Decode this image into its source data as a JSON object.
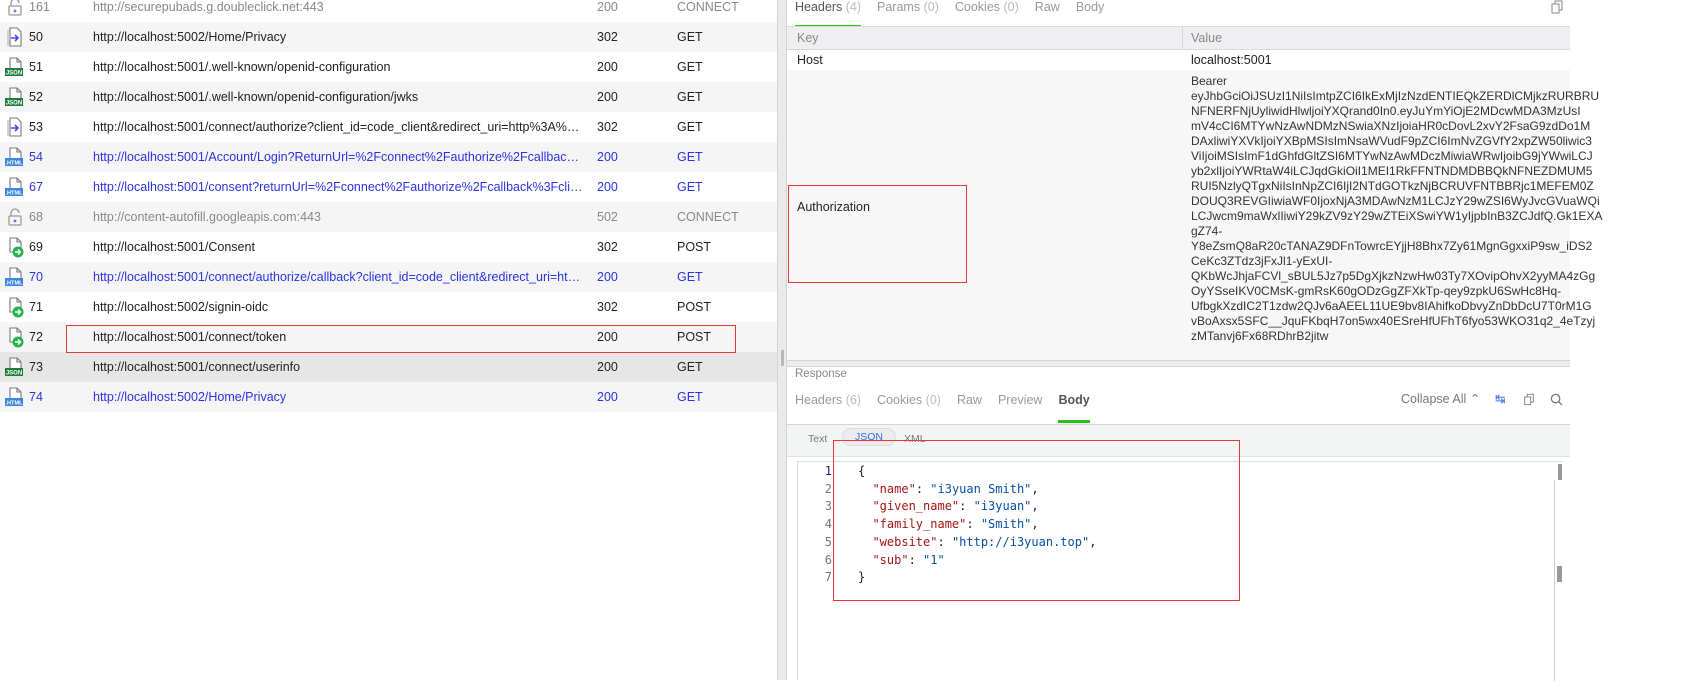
{
  "sessions": [
    {
      "id": "161",
      "url": "http://securepubads.g.doubleclick.net:443",
      "status": "200",
      "method": "CONNECT",
      "icon": "lock-icon",
      "style": "gray"
    },
    {
      "id": "50",
      "url": "http://localhost:5002/Home/Privacy",
      "status": "302",
      "method": "GET",
      "icon": "redirect-icon",
      "style": "normal"
    },
    {
      "id": "51",
      "url": "http://localhost:5001/.well-known/openid-configuration",
      "status": "200",
      "method": "GET",
      "icon": "json-icon",
      "style": "normal"
    },
    {
      "id": "52",
      "url": "http://localhost:5001/.well-known/openid-configuration/jwks",
      "status": "200",
      "method": "GET",
      "icon": "json-icon",
      "style": "normal"
    },
    {
      "id": "53",
      "url": "http://localhost:5001/connect/authorize?client_id=code_client&redirect_uri=http%3A%2F%2...",
      "status": "302",
      "method": "GET",
      "icon": "redirect-icon",
      "style": "normal"
    },
    {
      "id": "54",
      "url": "http://localhost:5001/Account/Login?ReturnUrl=%2Fconnect%2Fauthorize%2Fcallback%3Fcli...",
      "status": "200",
      "method": "GET",
      "icon": "html-icon",
      "style": "blue"
    },
    {
      "id": "67",
      "url": "http://localhost:5001/consent?returnUrl=%2Fconnect%2Fauthorize%2Fcallback%3Fclient_id...",
      "status": "200",
      "method": "GET",
      "icon": "html-icon",
      "style": "blue"
    },
    {
      "id": "68",
      "url": "http://content-autofill.googleapis.com:443",
      "status": "502",
      "method": "CONNECT",
      "icon": "lock-icon",
      "style": "gray"
    },
    {
      "id": "69",
      "url": "http://localhost:5001/Consent",
      "status": "302",
      "method": "POST",
      "icon": "post-icon",
      "style": "normal"
    },
    {
      "id": "70",
      "url": "http://localhost:5001/connect/authorize/callback?client_id=code_client&redirect_uri=http%3...",
      "status": "200",
      "method": "GET",
      "icon": "html-icon",
      "style": "blue"
    },
    {
      "id": "71",
      "url": "http://localhost:5002/signin-oidc",
      "status": "302",
      "method": "POST",
      "icon": "post-icon",
      "style": "normal"
    },
    {
      "id": "72",
      "url": "http://localhost:5001/connect/token",
      "status": "200",
      "method": "POST",
      "icon": "post-icon",
      "style": "normal"
    },
    {
      "id": "73",
      "url": "http://localhost:5001/connect/userinfo",
      "status": "200",
      "method": "GET",
      "icon": "json-icon",
      "style": "selected"
    },
    {
      "id": "74",
      "url": "http://localhost:5002/Home/Privacy",
      "status": "200",
      "method": "GET",
      "icon": "html-icon",
      "style": "blue"
    }
  ],
  "request": {
    "tabs": [
      {
        "label": "Headers",
        "count": "(4)",
        "active": true
      },
      {
        "label": "Params",
        "count": "(0)"
      },
      {
        "label": "Cookies",
        "count": "(0)"
      },
      {
        "label": "Raw",
        "count": ""
      },
      {
        "label": "Body",
        "count": ""
      }
    ],
    "columns": {
      "key": "Key",
      "value": "Value"
    },
    "headers": [
      {
        "key": "Host",
        "value": "localhost:5001"
      },
      {
        "key": "Authorization",
        "value": "Bearer\neyJhbGciOiJSUzI1NiIsImtpZCI6IkExMjIzNzdENTIEQkZERDlCMjkzRURBRU\nNFNERFNjUyliwidHlwljoiYXQrand0In0.eyJuYmYiOjE2MDcwMDA3MzUsI\nmV4cCI6MTYwNzAwNDMzNSwiaXNzIjoiaHR0cDovL2xvY2FsaG9zdDo1M\nDAxliwiYXVkIjoiYXBpMSIsImNsaWVudF9pZCI6ImNvZGVfY2xpZW50liwic3\nViIjoiMSIsImF1dGhfdGltZSI6MTYwNzAwMDczMiwiaWRwIjoibG9jYWwiLCJ\nyb2xlIjoiYWRtaW4iLCJqdGkiOiI1MEI1RkFFNTNDMDBBQkNFNEZDMUM5\nRUI5NzlyQTgxNiIsInNpZCI6IjI2NTdGOTkzNjBCRUVFNTBBRjc1MEFEM0Z\nDOUQ3REVGIiwiaWF0IjoxNjA3MDAwNzM1LCJzY29wZSI6WyJvcGVuaWQi\nLCJwcm9maWxlIiwiY29kZV9zY29wZTEiXSwiYW1yIjpbInB3ZCJdfQ.Gk1EXA\ngZ74-\nY8eZsmQ8aR20cTANAZ9DFnTowrcEYjjH8Bhx7Zy61MgnGgxxiP9sw_iDS2\nCeKc3ZTdz3jFxJl1-yExUI-\nQKbWcJhjaFCVl_sBUL5Jz7p5DgXjkzNzwHw03Ty7XOvipOhvX2yyMA4zGg\nOyYSseIKV0CMsK-gmRsK60gODzGgZFXkTp-qey9zpkU6SwHc8Hq-\nUfbgkXzdIC2T1zdw2QJv6aAEEL11UE9bv8IAhifkoDbvyZnDbDcU7T0rM1G\nvBoAxsx5SFC__JquFKbqH7on5wx40ESreHfUFhT6fyo53WKO31q2_4eTzyj\nzMTanvj6Fx68RDhrB2jitw"
      }
    ]
  },
  "response": {
    "label": "Response",
    "tabs": [
      {
        "label": "Headers",
        "count": "(6)"
      },
      {
        "label": "Cookies",
        "count": "(0)"
      },
      {
        "label": "Raw",
        "count": ""
      },
      {
        "label": "Preview",
        "count": ""
      },
      {
        "label": "Body",
        "count": "",
        "active": true
      }
    ],
    "collapse_all": "Collapse All",
    "formats": [
      "Text",
      "JSON",
      "XML"
    ],
    "active_format": "JSON",
    "code_lines": [
      [
        {
          "t": "p",
          "v": "{"
        }
      ],
      [
        {
          "t": "p",
          "v": "  "
        },
        {
          "t": "k",
          "v": "\"name\""
        },
        {
          "t": "p",
          "v": ": "
        },
        {
          "t": "s",
          "v": "\"i3yuan Smith\""
        },
        {
          "t": "p",
          "v": ","
        }
      ],
      [
        {
          "t": "p",
          "v": "  "
        },
        {
          "t": "k",
          "v": "\"given_name\""
        },
        {
          "t": "p",
          "v": ": "
        },
        {
          "t": "s",
          "v": "\"i3yuan\""
        },
        {
          "t": "p",
          "v": ","
        }
      ],
      [
        {
          "t": "p",
          "v": "  "
        },
        {
          "t": "k",
          "v": "\"family_name\""
        },
        {
          "t": "p",
          "v": ": "
        },
        {
          "t": "s",
          "v": "\"Smith\""
        },
        {
          "t": "p",
          "v": ","
        }
      ],
      [
        {
          "t": "p",
          "v": "  "
        },
        {
          "t": "k",
          "v": "\"website\""
        },
        {
          "t": "p",
          "v": ": "
        },
        {
          "t": "s",
          "v": "\"http://i3yuan.top\""
        },
        {
          "t": "p",
          "v": ","
        }
      ],
      [
        {
          "t": "p",
          "v": "  "
        },
        {
          "t": "k",
          "v": "\"sub\""
        },
        {
          "t": "p",
          "v": ": "
        },
        {
          "t": "s",
          "v": "\"1\""
        }
      ],
      [
        {
          "t": "p",
          "v": "}"
        }
      ]
    ]
  },
  "colors": {
    "accent_green": "#2cbf1a",
    "link_blue": "#2b33e0",
    "highlight_red": "#e53935",
    "json_key": "#a31515",
    "json_string": "#0451a5"
  }
}
